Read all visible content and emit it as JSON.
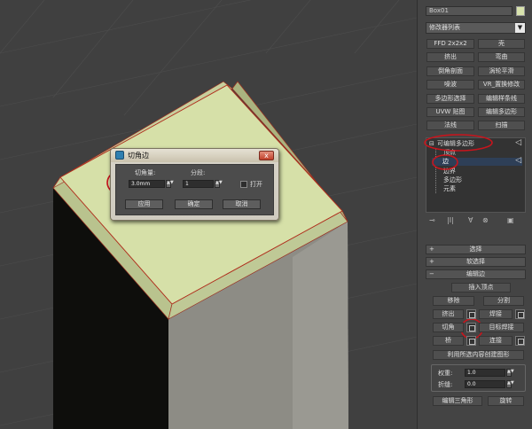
{
  "dialog": {
    "title": "切角边",
    "amount_label": "切角量:",
    "amount_value": "3.0mm",
    "segments_label": "分段:",
    "segments_value": "1",
    "open_label": "打开",
    "apply_label": "应用",
    "ok_label": "确定",
    "cancel_label": "取消",
    "close_label": "x"
  },
  "panel": {
    "object_name": "Box01",
    "object_color": "#d8e3ad",
    "modifier_list_label": "修改器列表",
    "modifier_buttons": [
      [
        "FFD 2x2x2",
        "壳"
      ],
      [
        "挤出",
        "弯曲"
      ],
      [
        "倒角剖面",
        "涡轮平滑"
      ],
      [
        "噪波",
        "VR_置换修改"
      ],
      [
        "多边形选择",
        "编辑样条线"
      ],
      [
        "UVW 贴图",
        "编辑多边形"
      ],
      [
        "法线",
        "扫描"
      ]
    ],
    "stack": {
      "root": "可编辑多边形",
      "items": [
        "顶点",
        "边",
        "边界",
        "多边形",
        "元素"
      ],
      "selected_index": 1
    },
    "rollouts": {
      "select": "选择",
      "soft_select": "软选择",
      "edit_edges": "编辑边"
    },
    "edit_edges": {
      "insert_vertex": "插入顶点",
      "remove": "移除",
      "split": "分割",
      "extrude": "挤出",
      "weld": "焊接",
      "chamfer": "切角",
      "target_weld": "目标焊接",
      "bridge": "桥",
      "connect": "连接",
      "create_shape": "利用所选内容创建图形",
      "weight_label": "权重:",
      "weight_value": "1.0",
      "crease_label": "折缝:",
      "crease_value": "0.0",
      "edit_triangles": "编辑三角形",
      "turn": "旋转"
    }
  }
}
